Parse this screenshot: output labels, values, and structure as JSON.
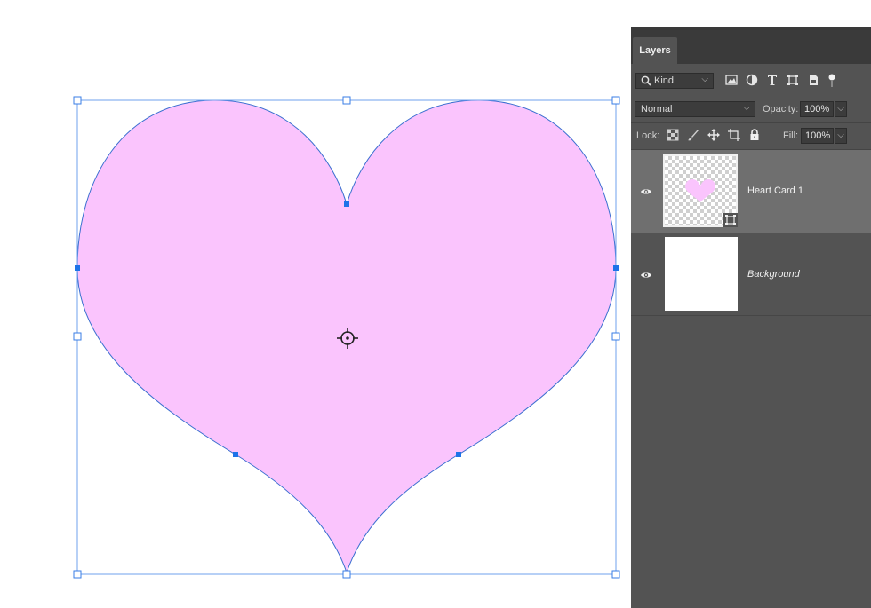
{
  "canvas": {
    "heart_fill": "#fac4fd",
    "path_stroke": "#3a6fd0",
    "handle_color": "#1e73e8"
  },
  "layers_panel": {
    "tab_label": "Layers",
    "filter": {
      "kind_label": "Kind",
      "icons": [
        "pixel-filter-icon",
        "adjustment-filter-icon",
        "type-filter-icon",
        "shape-filter-icon",
        "smart-object-filter-icon",
        "filter-toggle-icon"
      ]
    },
    "blend_mode": "Normal",
    "opacity_label": "Opacity:",
    "opacity_value": "100%",
    "lock_label": "Lock:",
    "fill_label": "Fill:",
    "fill_value": "100%",
    "layers": [
      {
        "name": "Heart Card 1",
        "selected": true,
        "visible": true,
        "type": "shape"
      },
      {
        "name": "Background",
        "selected": false,
        "visible": true,
        "type": "background"
      }
    ]
  }
}
